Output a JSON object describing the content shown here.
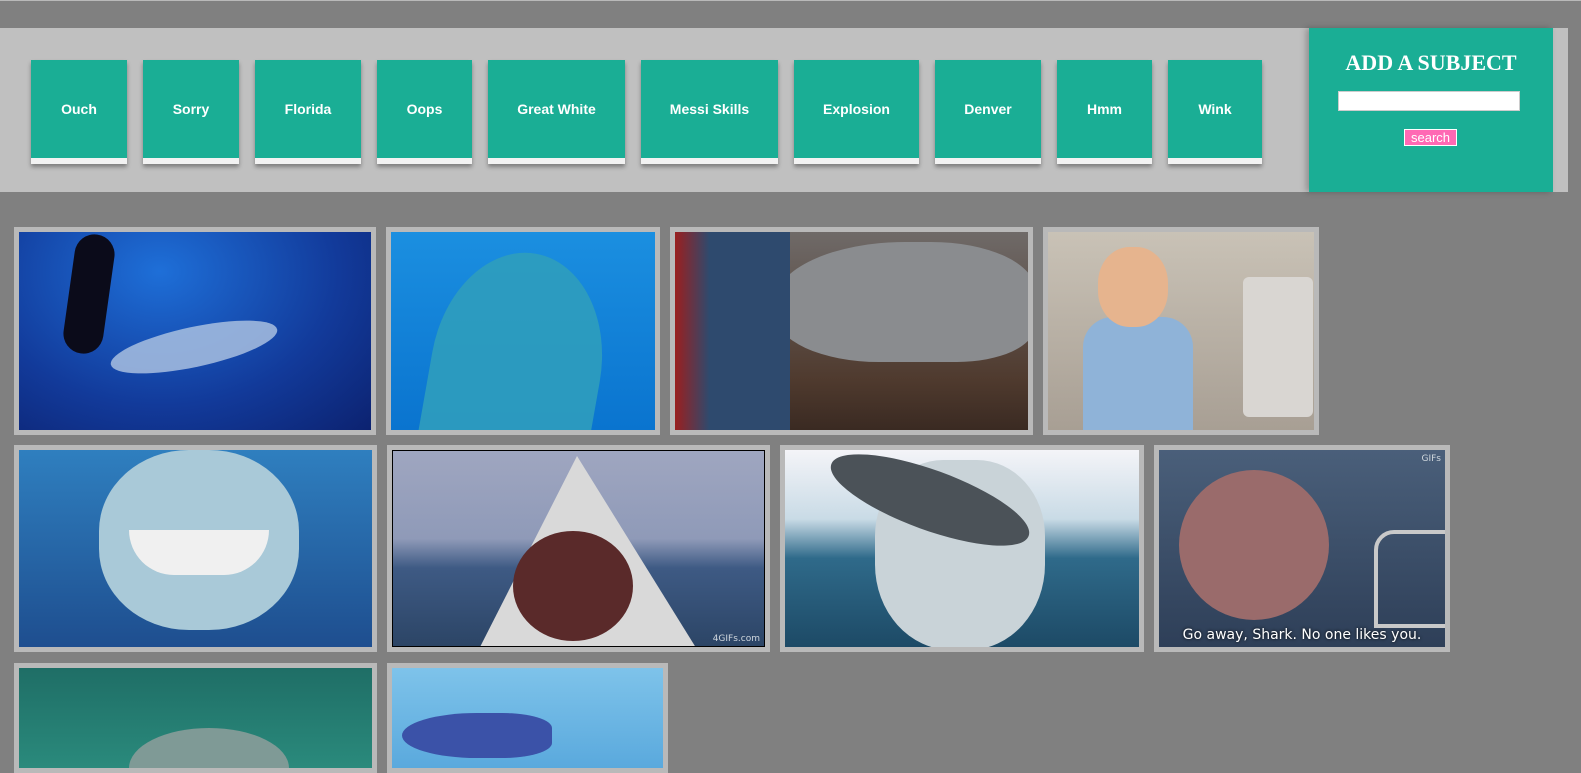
{
  "nav": {
    "buttons": [
      "Ouch",
      "Sorry",
      "Florida",
      "Oops",
      "Great White",
      "Messi Skills",
      "Explosion",
      "Denver",
      "Hmm",
      "Wink"
    ]
  },
  "add_subject": {
    "title": "ADD A SUBJECT",
    "input_value": "",
    "search_label": "search"
  },
  "gifs": [
    {
      "subject": "diver and great white shark underwater"
    },
    {
      "subject": "shark swimming toward camera"
    },
    {
      "subject": "shark puppet on wooden floor"
    },
    {
      "subject": "boy at computer thumbs up"
    },
    {
      "subject": "smiling cartoon shark"
    },
    {
      "subject": "shark breaching with seal",
      "watermark": "4GIFs.com"
    },
    {
      "subject": "shark breaching with fish"
    },
    {
      "subject": "shark at boat",
      "caption": "Go away, Shark. No one likes you.",
      "watermark": "GIFs"
    },
    {
      "subject": "shark in green water"
    },
    {
      "subject": "cartoon shark"
    }
  ],
  "colors": {
    "page_bg": "#808080",
    "header_bg": "#c0c0c0",
    "button_bg": "#1aae95",
    "search_button": "#ff69b4",
    "tile_border": "#b9b9b9"
  }
}
